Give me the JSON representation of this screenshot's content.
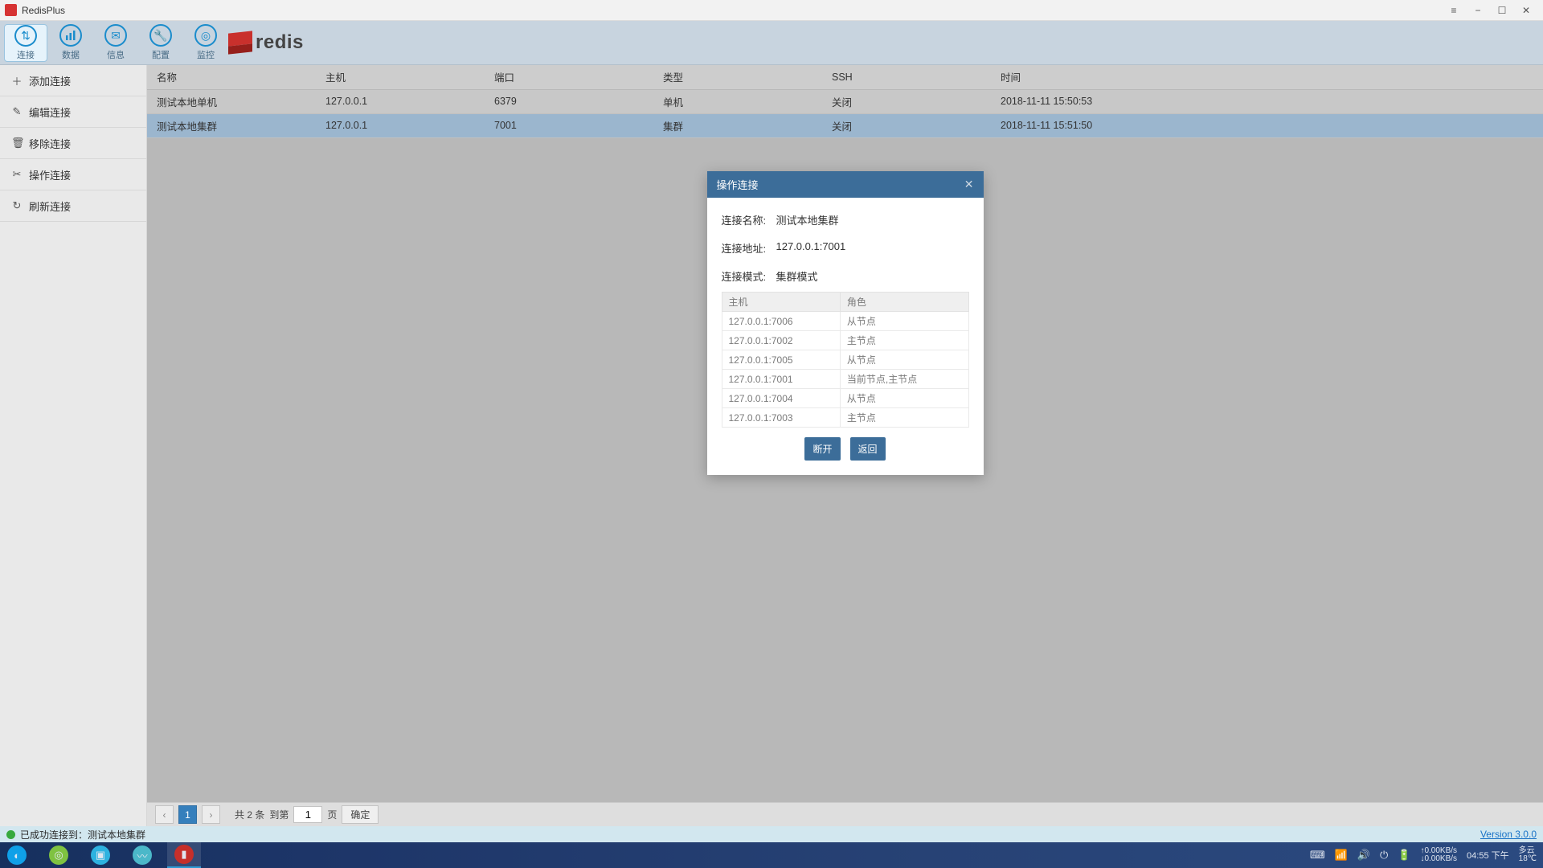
{
  "window": {
    "title": "RedisPlus"
  },
  "tabs": [
    {
      "label": "连接"
    },
    {
      "label": "数据"
    },
    {
      "label": "信息"
    },
    {
      "label": "配置"
    },
    {
      "label": "监控"
    }
  ],
  "logo_text": "redis",
  "sidebar": [
    {
      "label": "添加连接"
    },
    {
      "label": "编辑连接"
    },
    {
      "label": "移除连接"
    },
    {
      "label": "操作连接"
    },
    {
      "label": "刷新连接"
    }
  ],
  "columns": {
    "name": "名称",
    "host": "主机",
    "port": "端口",
    "type": "类型",
    "ssh": "SSH",
    "time": "时间"
  },
  "rows": [
    {
      "name": "测试本地单机",
      "host": "127.0.0.1",
      "port": "6379",
      "type": "单机",
      "ssh": "关闭",
      "time": "2018-11-11 15:50:53"
    },
    {
      "name": "测试本地集群",
      "host": "127.0.0.1",
      "port": "7001",
      "type": "集群",
      "ssh": "关闭",
      "time": "2018-11-11 15:51:50"
    }
  ],
  "pager": {
    "total_label": "共 2 条",
    "goto_label": "到第",
    "page_suffix": "页",
    "page_value": "1",
    "confirm": "确定",
    "current": "1"
  },
  "status": {
    "message": "已成功连接到：测试本地集群",
    "version": "Version 3.0.0"
  },
  "modal": {
    "title": "操作连接",
    "name_label": "连接名称:",
    "name_value": "测试本地集群",
    "addr_label": "连接地址:",
    "addr_value": "127.0.0.1:7001",
    "mode_label": "连接模式:",
    "mode_value": "集群模式",
    "col_host": "主机",
    "col_role": "角色",
    "nodes": [
      {
        "host": "127.0.0.1:7006",
        "role": "从节点"
      },
      {
        "host": "127.0.0.1:7002",
        "role": "主节点"
      },
      {
        "host": "127.0.0.1:7005",
        "role": "从节点"
      },
      {
        "host": "127.0.0.1:7001",
        "role": "当前节点,主节点"
      },
      {
        "host": "127.0.0.1:7004",
        "role": "从节点"
      },
      {
        "host": "127.0.0.1:7003",
        "role": "主节点"
      }
    ],
    "btn_disconnect": "断开",
    "btn_back": "返回"
  },
  "taskbar": {
    "net_up": "↑0.00KB/s",
    "net_down": "↓0.00KB/s",
    "clock": "04:55 下午",
    "weather1": "多云",
    "weather2": "18℃"
  }
}
